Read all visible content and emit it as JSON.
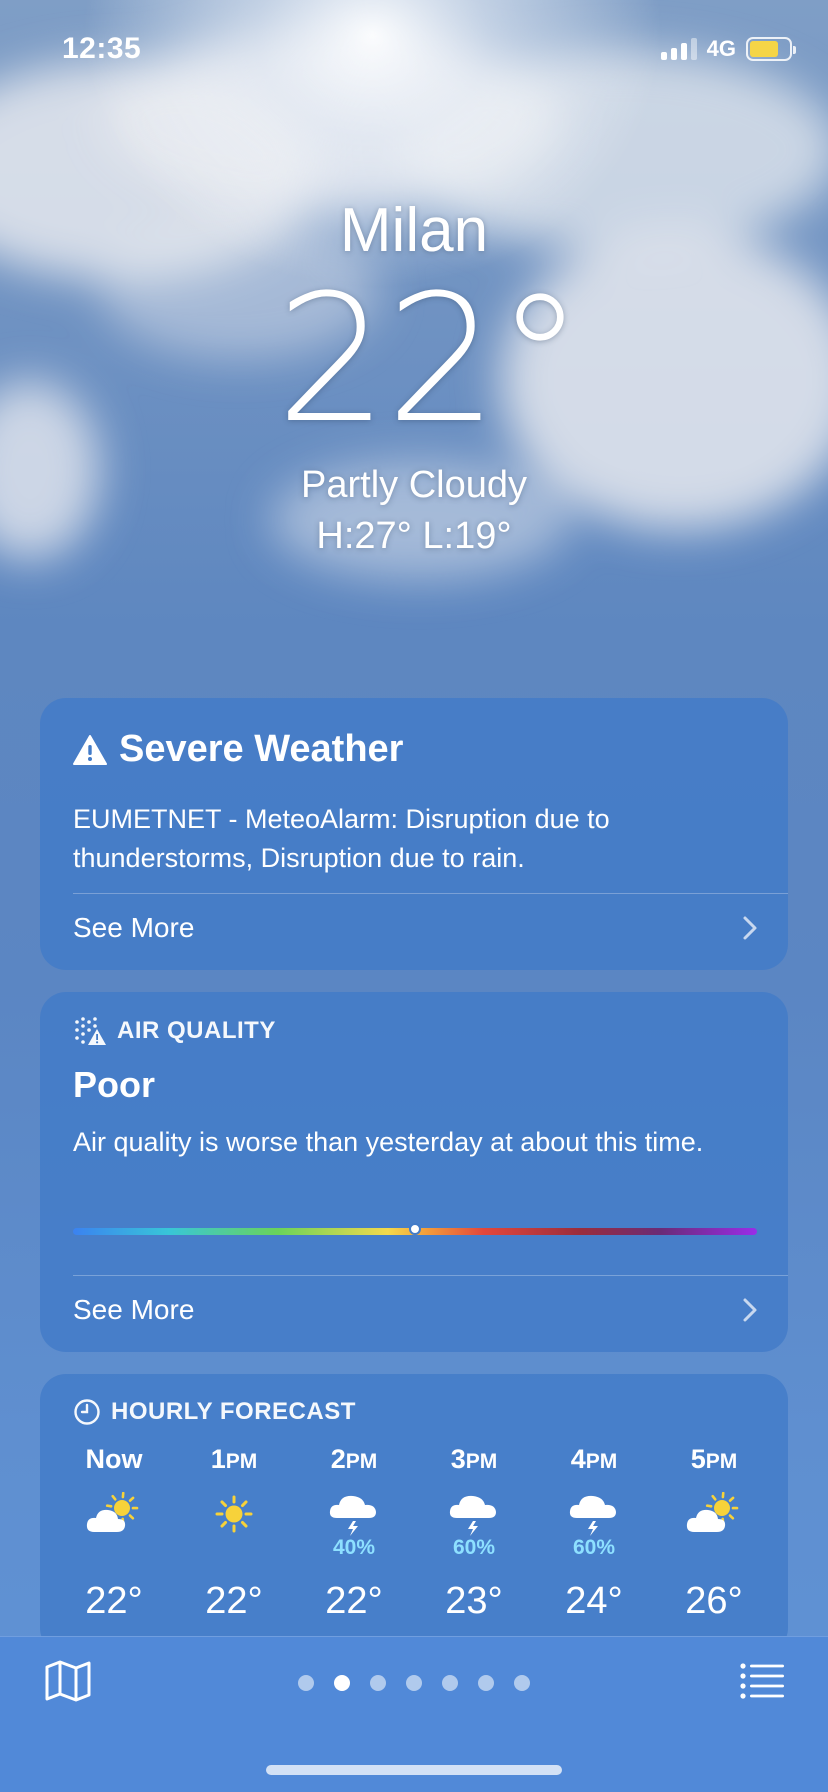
{
  "status_bar": {
    "time": "12:35",
    "network": "4G",
    "signal_bars": 3,
    "battery_level": 0.74
  },
  "location": {
    "city": "Milan",
    "temperature": "22°",
    "condition": "Partly Cloudy",
    "high_low": "H:27°  L:19°"
  },
  "severe_weather": {
    "title": "Severe Weather",
    "body": "EUMETNET - MeteoAlarm: Disruption due to thunderstorms, Disruption due to rain.",
    "see_more": "See More",
    "icon": "warning-triangle-icon"
  },
  "air_quality": {
    "header": "AIR QUALITY",
    "level": "Poor",
    "description": "Air quality is worse than yesterday at about this time.",
    "scale_position": 0.5,
    "see_more": "See More",
    "icon": "air-quality-icon"
  },
  "hourly_forecast": {
    "header": "HOURLY FORECAST",
    "icon": "clock-icon",
    "hours": [
      {
        "hour": "Now",
        "suffix": "",
        "icon": "partly-cloudy-icon",
        "precip": "",
        "temp": "22°"
      },
      {
        "hour": "1",
        "suffix": "PM",
        "icon": "sun-icon",
        "precip": "",
        "temp": "22°"
      },
      {
        "hour": "2",
        "suffix": "PM",
        "icon": "thunderstorm-icon",
        "precip": "40%",
        "temp": "22°"
      },
      {
        "hour": "3",
        "suffix": "PM",
        "icon": "thunderstorm-icon",
        "precip": "60%",
        "temp": "23°"
      },
      {
        "hour": "4",
        "suffix": "PM",
        "icon": "thunderstorm-icon",
        "precip": "60%",
        "temp": "24°"
      },
      {
        "hour": "5",
        "suffix": "PM",
        "icon": "partly-cloudy-icon",
        "precip": "",
        "temp": "26°"
      }
    ]
  },
  "tab_bar": {
    "page_count": 7,
    "active_page": 1,
    "left_icon": "map-icon",
    "right_icon": "list-icon"
  },
  "colors": {
    "card_background": "#427bc8",
    "precip_text": "#8ee0ff",
    "sun_yellow": "#f7d23a",
    "battery_yellow": "#f5d547"
  }
}
